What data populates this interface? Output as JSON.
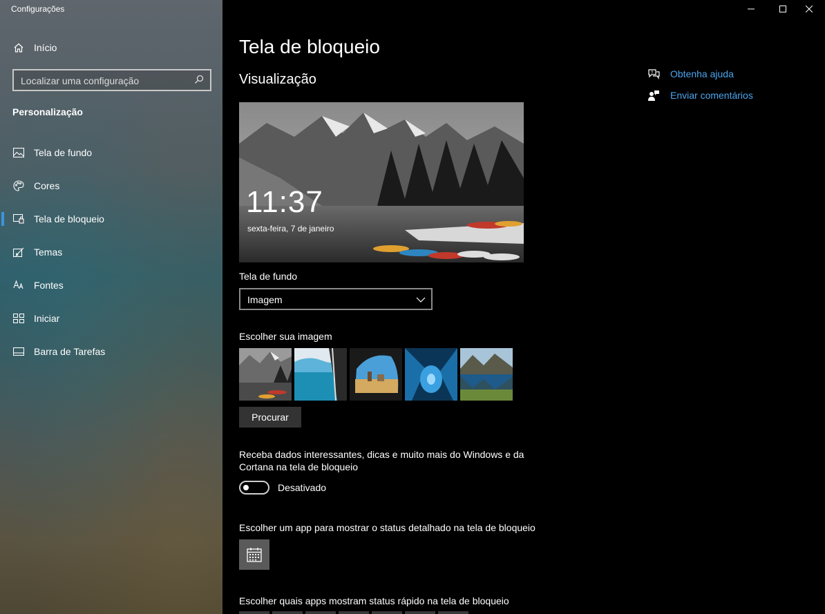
{
  "window": {
    "title": "Configurações"
  },
  "sidebar": {
    "home_label": "Início",
    "search_placeholder": "Localizar uma configuração",
    "section_title": "Personalização",
    "items": [
      {
        "label": "Tela de fundo",
        "icon": "image-icon",
        "active": false
      },
      {
        "label": "Cores",
        "icon": "palette-icon",
        "active": false
      },
      {
        "label": "Tela de bloqueio",
        "icon": "lock-screen-icon",
        "active": true
      },
      {
        "label": "Temas",
        "icon": "brush-icon",
        "active": false
      },
      {
        "label": "Fontes",
        "icon": "font-icon",
        "active": false
      },
      {
        "label": "Iniciar",
        "icon": "start-icon",
        "active": false
      },
      {
        "label": "Barra de Tarefas",
        "icon": "taskbar-icon",
        "active": false
      }
    ]
  },
  "main": {
    "page_title": "Tela de bloqueio",
    "preview_heading": "Visualização",
    "preview": {
      "time": "11:37",
      "date": "sexta-feira, 7 de janeiro"
    },
    "background_label": "Tela de fundo",
    "background_value": "Imagem",
    "choose_image_label": "Escolher sua imagem",
    "browse_label": "Procurar",
    "fun_facts_text_line1": "Receba dados interessantes, dicas e muito mais do Windows e da",
    "fun_facts_text_line2": "Cortana na tela de bloqueio",
    "toggle_state_label": "Desativado",
    "detailed_status_label": "Escolher um app para mostrar o status detalhado na tela de bloqueio",
    "quick_status_label": "Escolher quais apps mostram status rápido na tela de bloqueio"
  },
  "help": {
    "get_help": "Obtenha ajuda",
    "feedback": "Enviar comentários"
  },
  "colors": {
    "accent": "#3a96dd",
    "link": "#4aa5ee"
  }
}
